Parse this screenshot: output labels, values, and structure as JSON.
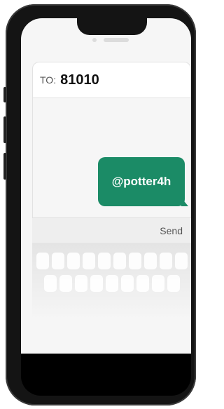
{
  "compose": {
    "to_label": "TO:",
    "to_number": "81010"
  },
  "message": {
    "text": "@potter4h",
    "bubble_color": "#1b8b66"
  },
  "composer": {
    "send_label": "Send"
  },
  "icons": [
    "camera-icon",
    "speaker-icon"
  ]
}
